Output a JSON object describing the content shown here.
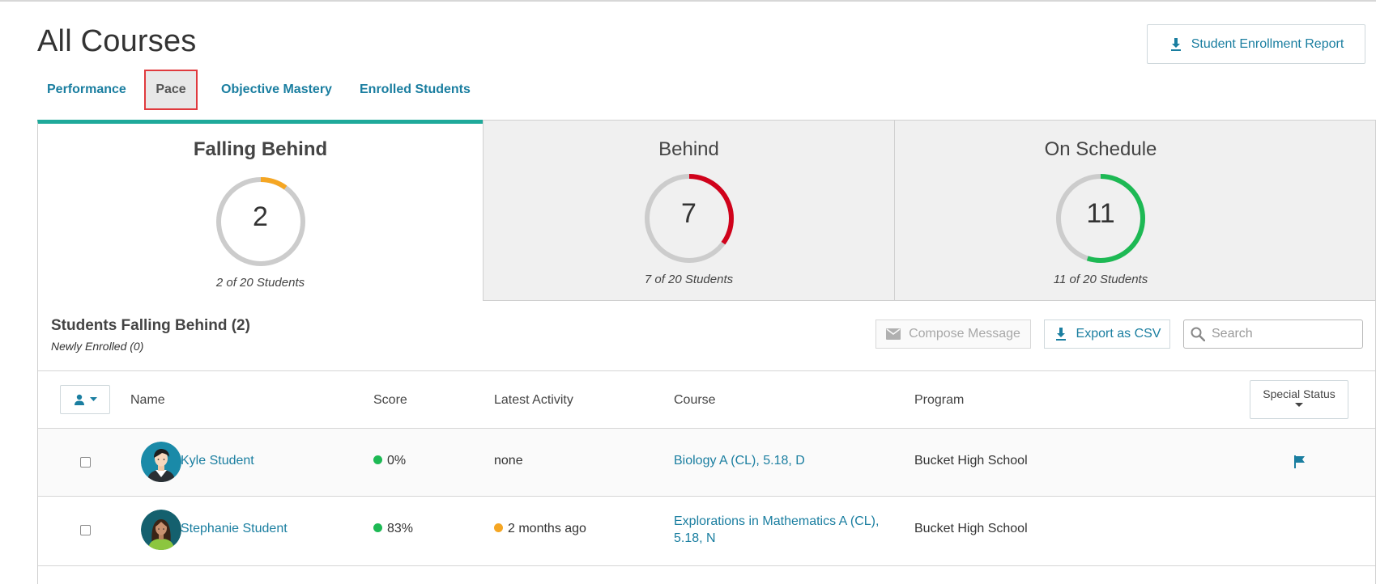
{
  "page": {
    "title": "All Courses"
  },
  "header": {
    "report_label": "Student Enrollment Report"
  },
  "tabs": [
    {
      "label": "Performance"
    },
    {
      "label": "Pace",
      "active": true
    },
    {
      "label": "Objective Mastery"
    },
    {
      "label": "Enrolled Students"
    }
  ],
  "summary": [
    {
      "title": "Falling Behind",
      "value": "2",
      "subtitle": "2 of 20 Students",
      "fraction": 0.1,
      "color": "#f5a623",
      "selected": true
    },
    {
      "title": "Behind",
      "value": "7",
      "subtitle": "7 of 20 Students",
      "fraction": 0.35,
      "color": "#d0021b",
      "selected": false
    },
    {
      "title": "On Schedule",
      "value": "11",
      "subtitle": "11 of 20 Students",
      "fraction": 0.55,
      "color": "#1db954",
      "selected": false
    }
  ],
  "section": {
    "title": "Students Falling Behind (2)",
    "subtitle": "Newly Enrolled (0)",
    "compose_label": "Compose Message",
    "export_label": "Export as CSV",
    "search_placeholder": "Search"
  },
  "table": {
    "columns": {
      "name": "Name",
      "score": "Score",
      "activity": "Latest Activity",
      "course": "Course",
      "program": "Program",
      "special": "Special Status"
    },
    "rows": [
      {
        "name": "Kyle Student",
        "score": "0%",
        "score_color": "#1db954",
        "activity": "none",
        "activity_dot": null,
        "course": "Biology A (CL), 5.18, D",
        "course_line2": "",
        "program": "Bucket High School",
        "flagged": true,
        "avatar": "male-student-icon"
      },
      {
        "name": "Stephanie Student",
        "score": "83%",
        "score_color": "#1db954",
        "activity": "2 months ago",
        "activity_dot": "#f5a623",
        "course": "Explorations in Mathematics A (CL),",
        "course_line2": "5.18, N",
        "program": "Bucket High School",
        "flagged": false,
        "avatar": "female-student-icon"
      }
    ]
  },
  "colors": {
    "accent": "#1a7ea0",
    "selected_border": "#1fa99a",
    "highlight_box": "#e03a3e",
    "track": "#cccccc"
  },
  "icons": [
    "download-icon",
    "mail-icon",
    "search-icon",
    "user-icon",
    "flag-icon"
  ]
}
